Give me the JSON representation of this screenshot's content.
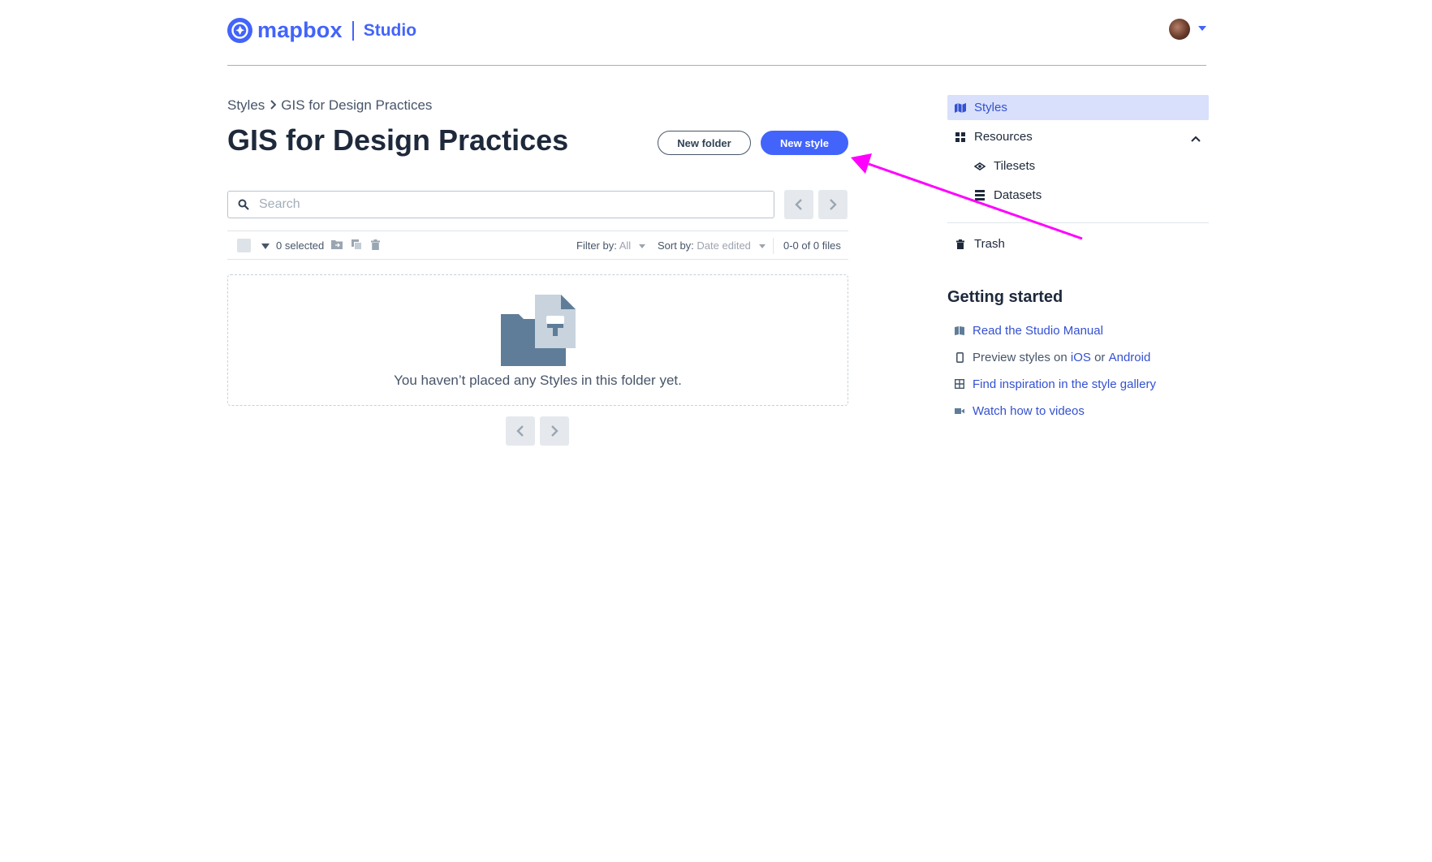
{
  "header": {
    "logo_text": "mapbox",
    "product": "Studio"
  },
  "breadcrumb": {
    "root": "Styles",
    "current": "GIS for Design Practices"
  },
  "page_title": "GIS for Design Practices",
  "actions": {
    "new_folder": "New folder",
    "new_style": "New style"
  },
  "search": {
    "placeholder": "Search",
    "value": ""
  },
  "toolbar": {
    "selected": "0 selected",
    "filter_label": "Filter by:",
    "filter_value": "All",
    "sort_label": "Sort by:",
    "sort_value": "Date edited",
    "count": "0-0 of 0 files"
  },
  "empty_state": {
    "message": "You haven’t placed any Styles in this folder yet."
  },
  "sidebar": {
    "items": [
      {
        "label": "Styles",
        "icon": "map-icon",
        "active": true
      },
      {
        "label": "Resources",
        "icon": "grid-icon",
        "expanded": true
      },
      {
        "label": "Tilesets",
        "icon": "tileset-icon"
      },
      {
        "label": "Datasets",
        "icon": "dataset-icon"
      },
      {
        "label": "Trash",
        "icon": "trash-icon"
      }
    ]
  },
  "getting_started": {
    "title": "Getting started",
    "manual": "Read the Studio Manual",
    "preview_prefix": "Preview styles on",
    "preview_ios": "iOS",
    "preview_or": "or",
    "preview_android": "Android",
    "gallery": "Find inspiration in the style gallery",
    "videos": "Watch how to videos"
  },
  "colors": {
    "accent": "#4264fb",
    "annotation_arrow": "#ff00ff",
    "active_nav_bg": "#d8e0fb"
  }
}
